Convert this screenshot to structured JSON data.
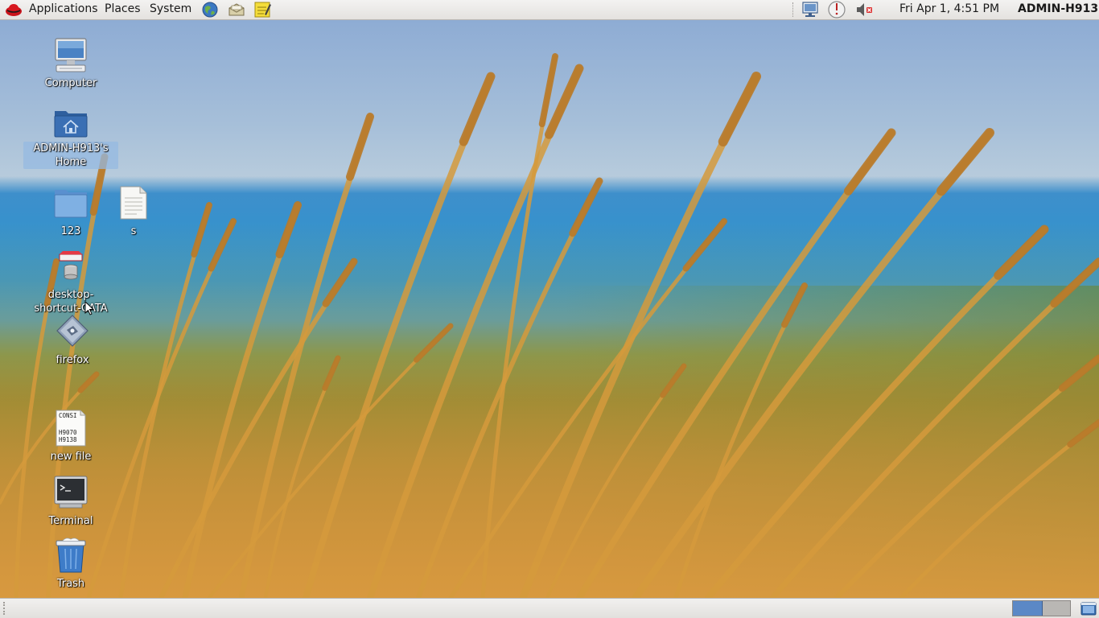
{
  "top_panel": {
    "menus": {
      "applications": "Applications",
      "places": "Places",
      "system": "System"
    },
    "launchers": [
      "browser-icon",
      "mail-icon",
      "notes-icon"
    ],
    "tray": [
      "network-display-icon",
      "software-update-icon",
      "volume-muted-icon"
    ],
    "clock": "Fri Apr  1,  4:51 PM",
    "user": "ADMIN-H913"
  },
  "desktop": {
    "icons": {
      "computer": "Computer",
      "home": "ADMIN-H913's Home",
      "folder_123": "123",
      "file_s": "s",
      "shortcut": "desktop-shortcut-CATA",
      "firefox": "firefox",
      "new_file": "new file",
      "terminal": "Terminal",
      "trash": "Trash"
    },
    "new_file_preview_lines": [
      "CONSI",
      "H9070",
      "H9138"
    ]
  },
  "bottom_panel": {
    "workspaces": [
      "Workspace 1",
      "Workspace 2"
    ],
    "active_workspace": 1
  },
  "colors": {
    "panel_bg": "#e9e7e4",
    "workspace_active": "#5b88c6",
    "sky": "#9fbad6",
    "sea": "#2a8fcf",
    "grass": "#d49a3a"
  }
}
